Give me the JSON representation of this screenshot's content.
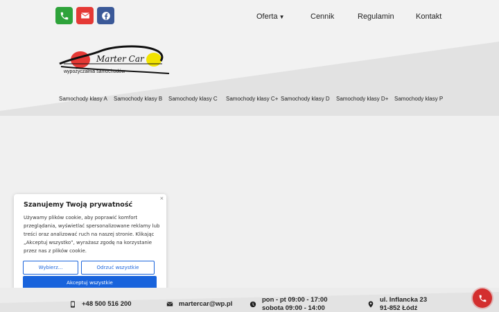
{
  "social": {
    "icons": [
      "phone-icon",
      "envelope-icon",
      "facebook-icon"
    ],
    "colors": {
      "phone": "#2ea33a",
      "mail": "#e53935",
      "facebook": "#3b5998"
    }
  },
  "topnav": {
    "items": [
      "Oferta",
      "Cennik",
      "Regulamin",
      "Kontakt"
    ]
  },
  "logo": {
    "title": "Marter Car",
    "subtitle": "wypożyczalnia samochodów"
  },
  "categories": [
    "Samochody klasy A",
    "Samochody klasy B",
    "Samochody klasy C",
    "Samochody klasy C+",
    "Samochody klasy D",
    "Samochody klasy D+",
    "Samochody klasy P"
  ],
  "cookie": {
    "title": "Szanujemy Twoją prywatność",
    "text": "Używamy plików cookie, aby poprawić komfort przeglądania, wyświetlać spersonalizowane reklamy lub treści oraz analizować ruch na naszej stronie. Klikając „Akceptuj wszystko”, wyrażasz zgodę na korzystanie przez nas z plików cookie.",
    "customize": "Wybierz...",
    "reject": "Odrzuć wszystkie",
    "accept": "Akceptuj wszystkie",
    "close": "×"
  },
  "footer": {
    "phone": "+48 500 516 200",
    "email": "martercar@wp.pl",
    "hours_line1": "pon - pt 09:00 - 17:00",
    "hours_line2": "sobota 09:00 - 14:00",
    "address_line1": "ul. Inflancka 23",
    "address_line2": "91-852 Łódź"
  },
  "accent_color": "#1863dc"
}
